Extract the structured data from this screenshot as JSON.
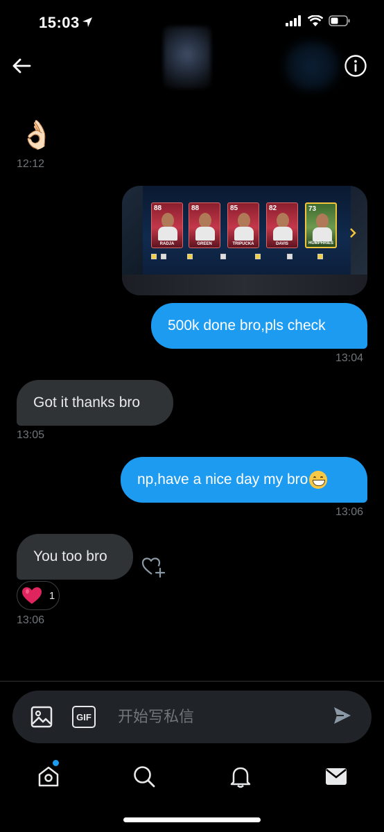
{
  "status": {
    "time": "15:03"
  },
  "header": {
    "back_label": "Back",
    "info_label": "Conversation info"
  },
  "messages": {
    "m1": {
      "emoji": "👌🏻",
      "time": "12:12"
    },
    "m2": {
      "cards": [
        {
          "rating": "88",
          "name": "RADJA"
        },
        {
          "rating": "88",
          "name": "GREEN"
        },
        {
          "rating": "85",
          "name": "TRIPUCKA"
        },
        {
          "rating": "82",
          "name": "DAVIS"
        },
        {
          "rating": "73",
          "name": "HUMPHRIES"
        }
      ]
    },
    "m3": {
      "text": "500k done bro,pls check",
      "time": "13:04"
    },
    "m4": {
      "text": "Got it thanks bro",
      "time": "13:05"
    },
    "m5": {
      "text": "np,have a nice day my bro",
      "time": "13:06"
    },
    "m6": {
      "text": "You too bro",
      "time": "13:06",
      "reaction_count": "1"
    }
  },
  "composer": {
    "placeholder": "开始写私信",
    "gif_label": "GIF"
  },
  "tabs": [
    "home-icon",
    "search-icon",
    "bell-icon",
    "mail-icon"
  ],
  "colors": {
    "accent": "#1d9bf0",
    "incoming": "#2f3336",
    "background": "#000000",
    "muted": "#71767b"
  }
}
